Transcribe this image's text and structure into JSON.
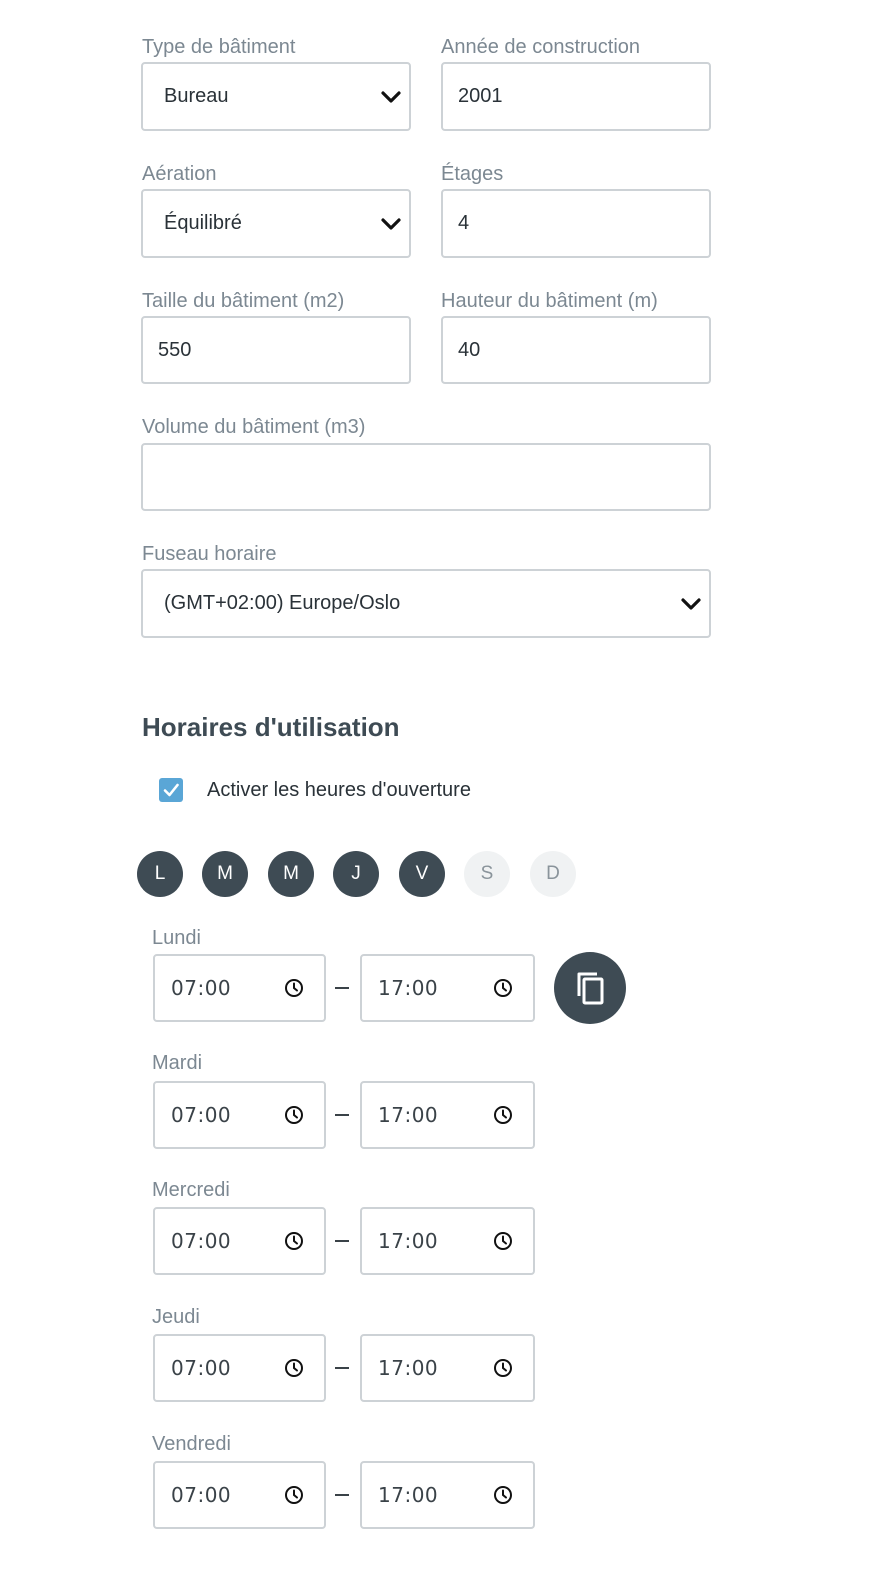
{
  "building": {
    "type_label": "Type de bâtiment",
    "type_value": "Bureau",
    "year_label": "Année de construction",
    "year_value": "2001",
    "ventilation_label": "Aération",
    "ventilation_value": "Équilibré",
    "floors_label": "Étages",
    "floors_value": "4",
    "size_label": "Taille du bâtiment (m2)",
    "size_value": "550",
    "height_label": "Hauteur du bâtiment (m)",
    "height_value": "40",
    "volume_label": "Volume du bâtiment (m3)",
    "volume_value": "",
    "timezone_label": "Fuseau horaire",
    "timezone_value": "(GMT+02:00) Europe/Oslo"
  },
  "schedule": {
    "title": "Horaires d'utilisation",
    "enable_label": "Activer les heures d'ouverture",
    "enable_checked": true,
    "days": [
      {
        "letter": "L",
        "active": true
      },
      {
        "letter": "M",
        "active": true
      },
      {
        "letter": "M",
        "active": true
      },
      {
        "letter": "J",
        "active": true
      },
      {
        "letter": "V",
        "active": true
      },
      {
        "letter": "S",
        "active": false
      },
      {
        "letter": "D",
        "active": false
      }
    ],
    "rows": [
      {
        "day": "Lundi",
        "start": "07:00",
        "end": "17:00"
      },
      {
        "day": "Mardi",
        "start": "07:00",
        "end": "17:00"
      },
      {
        "day": "Mercredi",
        "start": "07:00",
        "end": "17:00"
      },
      {
        "day": "Jeudi",
        "start": "07:00",
        "end": "17:00"
      },
      {
        "day": "Vendredi",
        "start": "07:00",
        "end": "17:00"
      }
    ]
  },
  "colors": {
    "accent": "#3e4b54",
    "checkbox": "#5aa6d6",
    "border": "#cdd2d6",
    "label": "#7c8892"
  },
  "icons": {
    "select": "chevron-down-icon",
    "time": "clock-icon",
    "copy": "copy-icon",
    "check": "check-icon"
  }
}
